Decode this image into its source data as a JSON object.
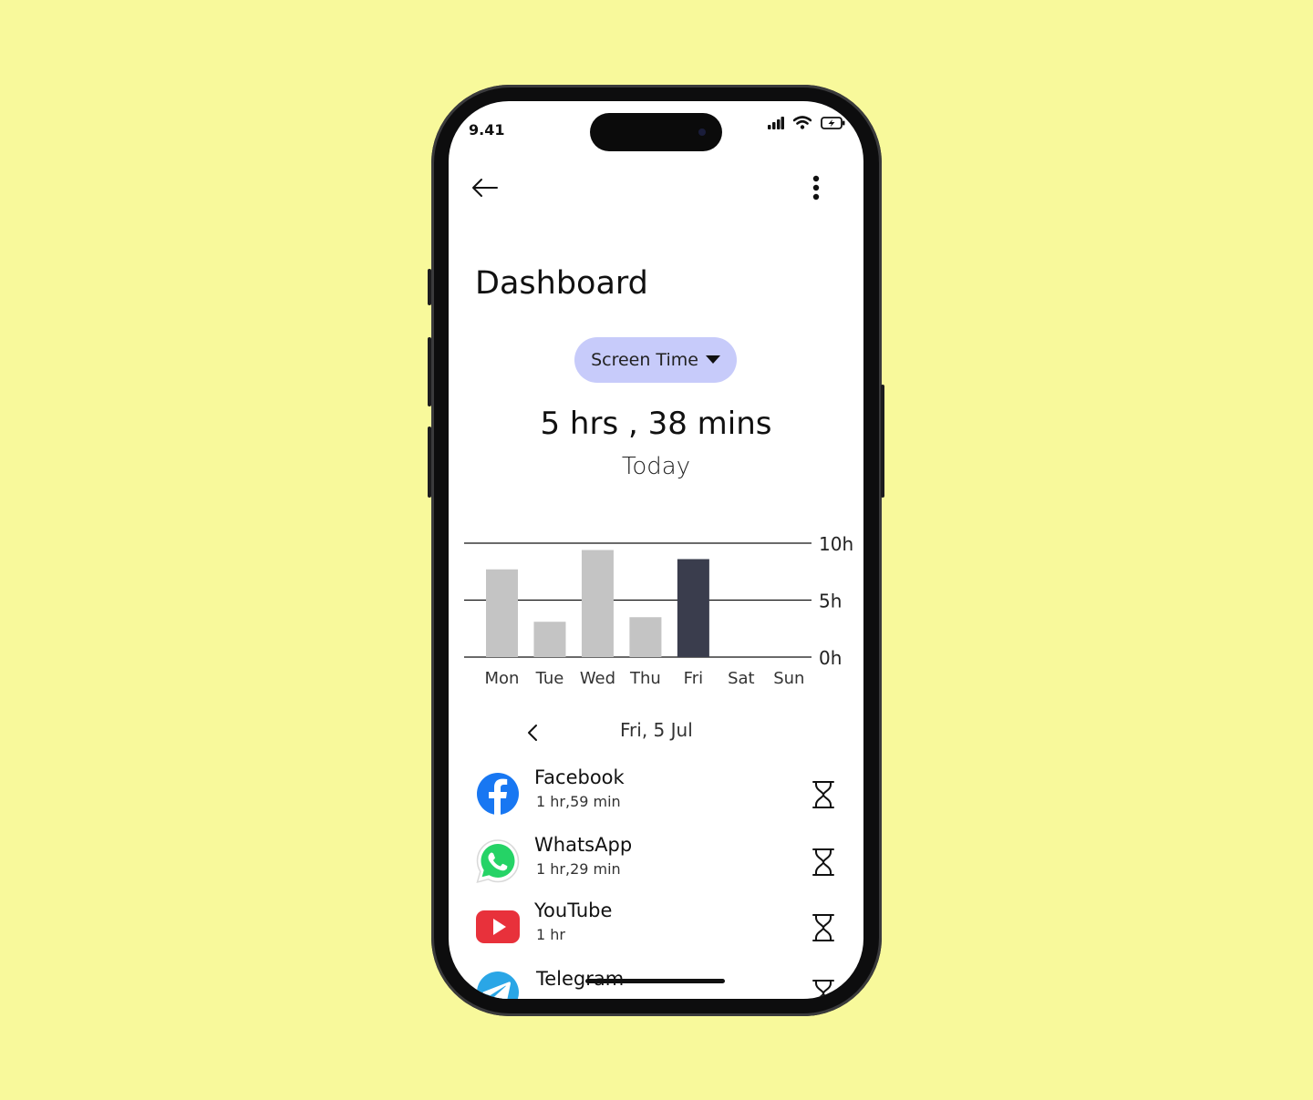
{
  "status_bar": {
    "time": "9.41"
  },
  "header": {
    "back_icon": "back-arrow-icon",
    "menu_icon": "more-vertical-icon"
  },
  "page": {
    "title": "Dashboard"
  },
  "metric_selector": {
    "label": "Screen Time",
    "icon": "caret-down-icon"
  },
  "summary": {
    "total": "5 hrs , 38 mins",
    "period": "Today"
  },
  "chart_data": {
    "type": "bar",
    "categories": [
      "Mon",
      "Tue",
      "Wed",
      "Thu",
      "Fri",
      "Sat",
      "Sun"
    ],
    "values": [
      7.7,
      3.1,
      9.4,
      3.5,
      8.6,
      0,
      0
    ],
    "highlight_index": 4,
    "bar_color": "#c4c4c4",
    "highlight_color": "#3a3d4d",
    "ylim": [
      0,
      10
    ],
    "ytick_labels": [
      "10h",
      "5h",
      "0h"
    ],
    "grid": true
  },
  "date_nav": {
    "prev_icon": "chevron-left-icon",
    "label": "Fri, 5 Jul"
  },
  "apps": [
    {
      "name": "Facebook",
      "duration": "1 hr,59 min",
      "icon": "facebook-icon"
    },
    {
      "name": "WhatsApp",
      "duration": "1 hr,29 min",
      "icon": "whatsapp-icon"
    },
    {
      "name": "YouTube",
      "duration": "1 hr",
      "icon": "youtube-icon"
    },
    {
      "name": "Telegram",
      "duration": "",
      "icon": "telegram-icon"
    }
  ],
  "colors": {
    "background": "#f8f99b",
    "chip": "#c7cbfa",
    "facebook": "#1877f2",
    "whatsapp": "#25d366",
    "youtube": "#e8313b",
    "telegram": "#2aa6e6"
  }
}
